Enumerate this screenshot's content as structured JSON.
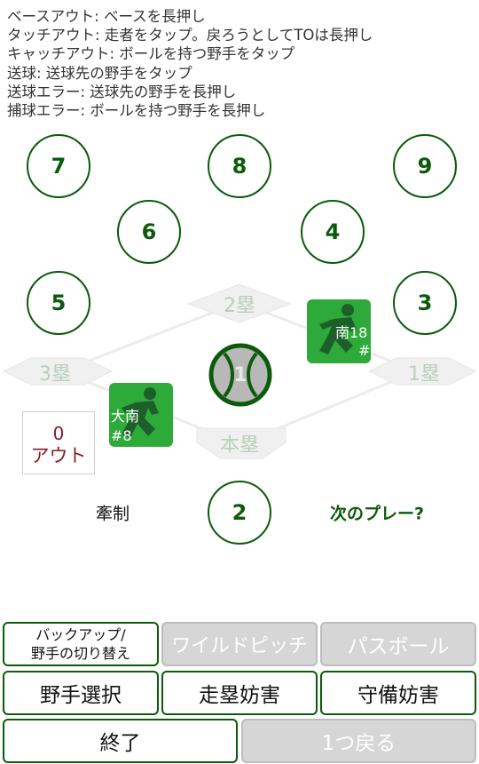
{
  "instructions": [
    "ベースアウト: ベースを長押し",
    "タッチアウト: 走者をタップ。戻ろうとしてTOは長押し",
    "キャッチアウト: ボールを持つ野手をタップ",
    "送球: 送球先の野手をタップ",
    "送球エラー: 送球先の野手を長押し",
    "捕球エラー: ボールを持つ野手を長押し"
  ],
  "positions": {
    "lf": "7",
    "cf": "8",
    "rf": "9",
    "ss": "6",
    "second": "4",
    "third": "5",
    "first": "3",
    "pitcher": "1",
    "catcher": "2"
  },
  "bases": {
    "second": "2塁",
    "third": "3塁",
    "first": "1塁",
    "home": "本塁"
  },
  "runners": {
    "first_runner": {
      "line1": "南18",
      "line2": "#"
    },
    "third_runner": {
      "line1": "大南",
      "line2": "#8"
    }
  },
  "outs": {
    "count": "0",
    "label": "アウト"
  },
  "labels": {
    "restraint": "牽制",
    "next_play": "次のプレー?"
  },
  "buttons": {
    "backup": "バックアップ/\n野手の切り替え",
    "wild_pitch": "ワイルドピッチ",
    "passed_ball": "パスボール",
    "select_fielder": "野手選択",
    "obstruction_runner": "走塁妨害",
    "obstruction_defense": "守備妨害",
    "end": "終了",
    "undo": "1つ戻る"
  },
  "colors": {
    "accent": "#0b5b0b",
    "runner_bg": "#2eaa3a",
    "out_text": "#8a1a2a",
    "disabled_bg": "#d6d6d6"
  },
  "icons": {
    "runner": "running-player-icon",
    "ball": "baseball-icon"
  }
}
